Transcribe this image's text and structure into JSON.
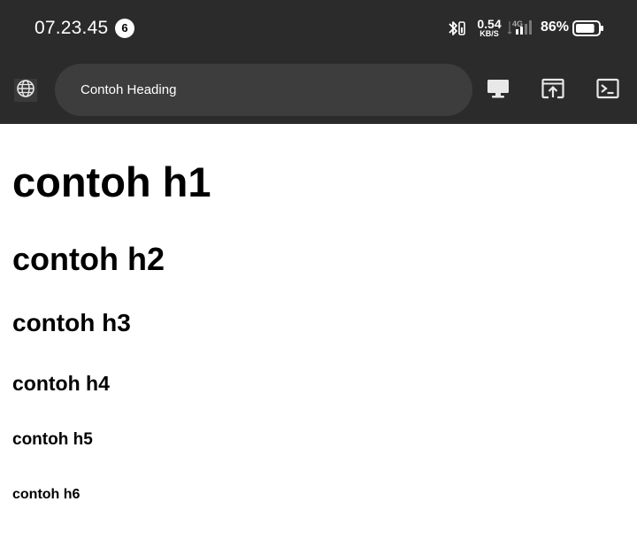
{
  "status_bar": {
    "time": "07.23.45",
    "notification_count": "6",
    "net_speed_value": "0.54",
    "net_speed_unit": "KB/S",
    "network_type": "4G",
    "battery_percent": "86%",
    "battery_level": 0.86
  },
  "toolbar": {
    "url_text": "Contoh Heading",
    "icons": [
      "globe-icon",
      "desktop-icon",
      "open-in-new-icon",
      "console-icon"
    ]
  },
  "content": {
    "h1": "contoh h1",
    "h2": "contoh h2",
    "h3": "contoh h3",
    "h4": "contoh h4",
    "h5": "contoh h5",
    "h6": "contoh h6"
  },
  "colors": {
    "bar_background": "#2b2b2b",
    "url_bar_background": "#3d3d3d",
    "page_background": "#ffffff"
  }
}
